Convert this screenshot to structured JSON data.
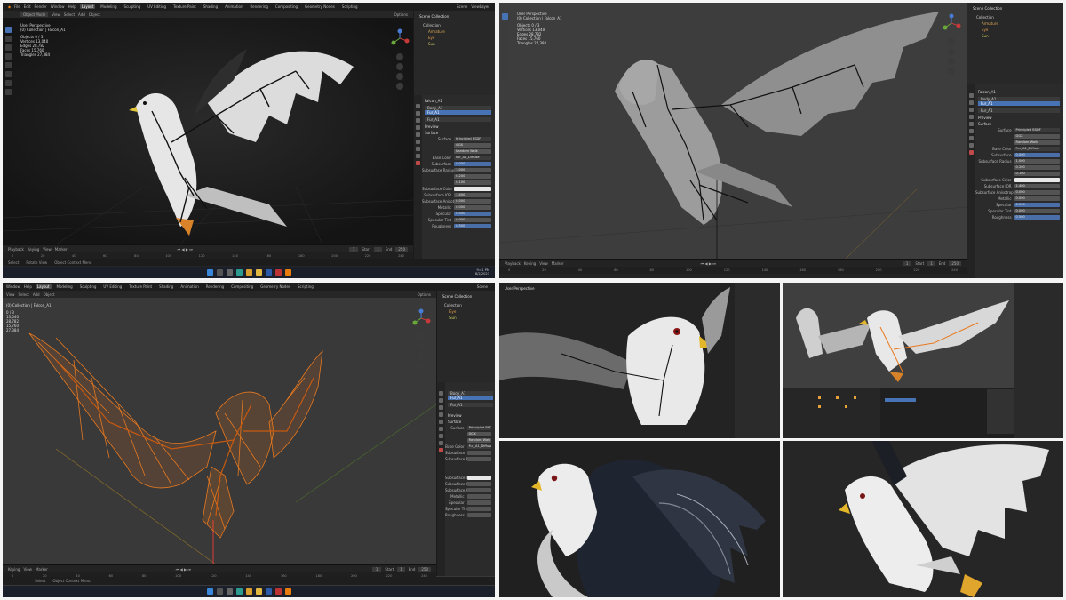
{
  "menu": [
    "File",
    "Edit",
    "Render",
    "Window",
    "Help"
  ],
  "workspaces": [
    "Layout",
    "Modeling",
    "Sculpting",
    "UV Editing",
    "Texture Paint",
    "Shading",
    "Animation",
    "Rendering",
    "Compositing",
    "Geometry Nodes",
    "Scripting"
  ],
  "viewport": {
    "perspective": "User Perspective",
    "collection": "(0) Collection | Falcon_A1",
    "stats": [
      [
        "Objects",
        "0 / 3"
      ],
      [
        "Vertices",
        "13,040"
      ],
      [
        "Edges",
        "28,782"
      ],
      [
        "Faces",
        "15,760"
      ],
      [
        "Triangles",
        "27,384"
      ]
    ],
    "mode": "Object Mode",
    "header_items": [
      "View",
      "Select",
      "Add",
      "Object"
    ],
    "options": "Options"
  },
  "scene": {
    "name": "Scene",
    "layer": "ViewLayer"
  },
  "outliner": {
    "title": "Scene Collection",
    "items": [
      "Collection",
      "Armature",
      "Eye",
      "Sun"
    ]
  },
  "material": {
    "object": "Falcon_A1",
    "slots": [
      "Body_A1",
      "Fur_A1"
    ],
    "name": "Fur_A1",
    "preview": "Preview",
    "surface_header": "Surface",
    "surface_shader": "Principled BSDF",
    "subsurface_method": "GGX",
    "distribution": "Random Walk",
    "rows": [
      [
        "Base Color",
        "Fur_A1_Diffuse"
      ],
      [
        "Subsurface",
        "0.000"
      ],
      [
        "Subsurface Radius",
        "1.000"
      ],
      [
        "",
        "0.200"
      ],
      [
        "",
        "0.100"
      ],
      [
        "Subsurface Color",
        ""
      ],
      [
        "Subsurface IOR",
        "1.400"
      ],
      [
        "Subsurface Anisotropy",
        "0.000"
      ],
      [
        "Metallic",
        "0.000"
      ],
      [
        "Specular",
        "0.500"
      ],
      [
        "Specular Tint",
        "0.000"
      ],
      [
        "Roughness",
        "0.500"
      ]
    ]
  },
  "timeline": {
    "items": [
      "Playback",
      "Keying",
      "View",
      "Marker"
    ],
    "frame": "1",
    "start_label": "Start",
    "start": "1",
    "end_label": "End",
    "end": "250",
    "ticks": [
      "0",
      "20",
      "40",
      "60",
      "80",
      "100",
      "120",
      "140",
      "160",
      "180",
      "200",
      "220",
      "240"
    ]
  },
  "status": [
    "Select",
    "Rotate View",
    "Object Context Menu"
  ],
  "taskbar": {
    "time": "9:41 PM",
    "date": "8/2/2023"
  },
  "colors": {
    "ui_bg": "#2a2a2a",
    "header": "#1d1d1d",
    "active_blue": "#4772b3",
    "wire_orange": "#e8791f",
    "armature": "#111111"
  }
}
